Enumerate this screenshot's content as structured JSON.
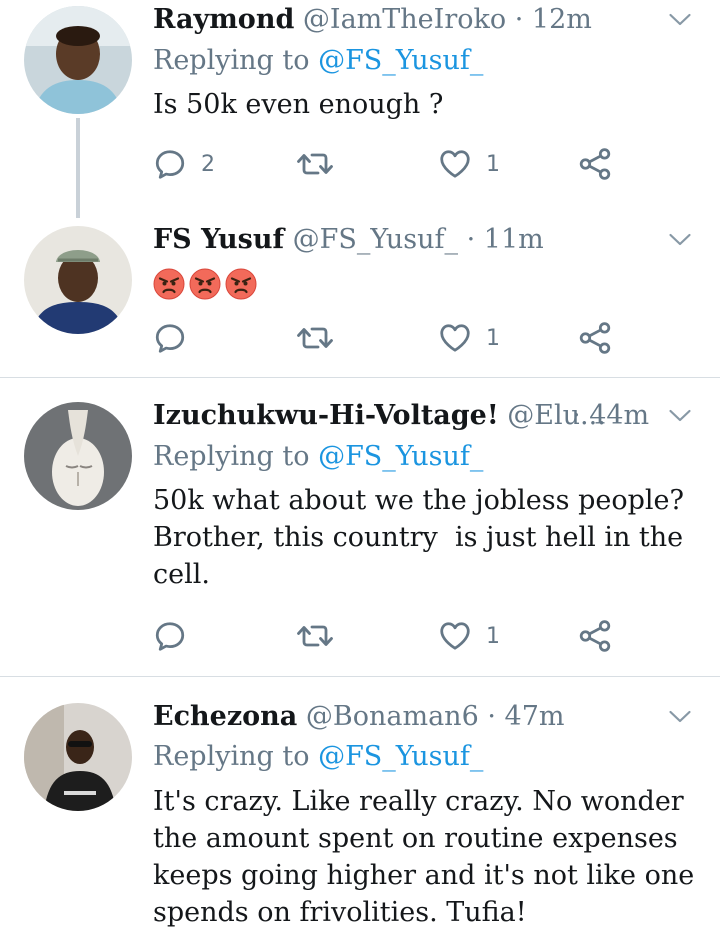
{
  "tweets": [
    {
      "name": "Raymond",
      "handle": "@IamTheIroko",
      "dot": "·",
      "time": "12m",
      "replying_prefix": "Replying to",
      "replying_to": "@FS_Yusuf_",
      "text": "Is 50k even enough ?",
      "reply_count": "2",
      "retweet_count": "",
      "like_count": "1"
    },
    {
      "name": "FS Yusuf",
      "handle": "@FS_Yusuf_",
      "dot": "·",
      "time": "11m",
      "text_emoji": [
        "angry-face",
        "angry-face",
        "angry-face"
      ],
      "reply_count": "",
      "retweet_count": "",
      "like_count": "1"
    },
    {
      "name": "Izuchukwu-Hi-Voltage!",
      "handle": "@Elu...",
      "dot": "·",
      "time": "44m",
      "replying_prefix": "Replying to",
      "replying_to": "@FS_Yusuf_",
      "text_line1": "50k what about we the jobless people?",
      "text_line2": "Brother, this country  is just hell in the",
      "text_line3": "cell.",
      "reply_count": "",
      "retweet_count": "",
      "like_count": "1"
    },
    {
      "name": "Echezona",
      "handle": "@Bonaman6",
      "dot": "·",
      "time": "47m",
      "replying_prefix": "Replying to",
      "replying_to": "@FS_Yusuf_",
      "text_line1": "It's crazy. Like really crazy. No wonder",
      "text_line2": "the amount spent on routine expenses",
      "text_line3": "keeps going higher and it's not like one",
      "text_line4": "spends on frivolities. Tufia!"
    }
  ],
  "icons": {
    "reply": "comment-icon",
    "retweet": "retweet-icon",
    "like": "heart-icon",
    "share": "share-icon",
    "menu": "chevron-down-icon"
  },
  "colors": {
    "text": "#14171a",
    "muted": "#657786",
    "mention": "#1b95e0",
    "thread_line": "#c9d1d8",
    "divider": "#d8dee3"
  }
}
